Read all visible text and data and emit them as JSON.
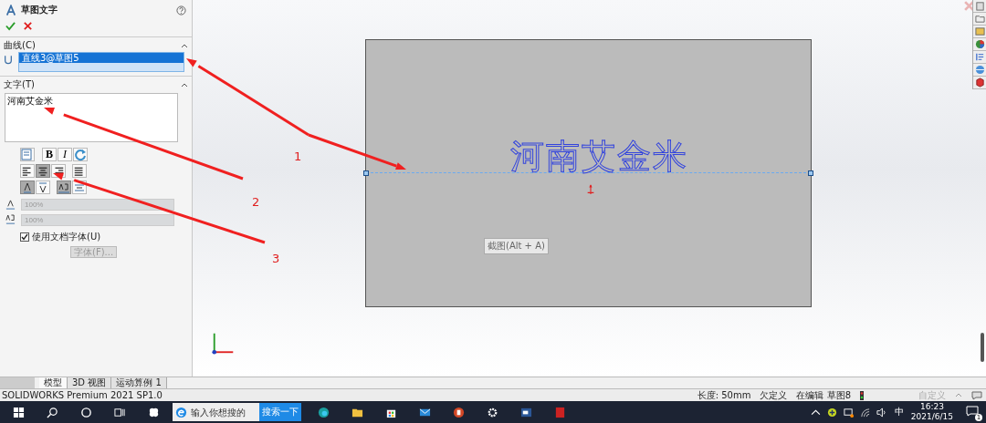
{
  "panel": {
    "title": "草图文字",
    "curves": {
      "heading": "曲线(C)",
      "items": [
        {
          "label": "直线3@草图5",
          "selected": true
        }
      ]
    },
    "text": {
      "heading": "文字(T)",
      "value": "河南艾金米"
    },
    "style_buttons": [
      {
        "label": "B",
        "kind": "bold"
      },
      {
        "label": "I",
        "kind": "italic"
      }
    ],
    "alignment": [
      {
        "kind": "left",
        "selected": false
      },
      {
        "kind": "center",
        "selected": true
      },
      {
        "kind": "right",
        "selected": false
      },
      {
        "kind": "justify",
        "selected": false
      }
    ],
    "flip": [
      {
        "kind": "vertical",
        "selected": true
      },
      {
        "kind": "down",
        "selected": false
      },
      {
        "kind": "horizontal",
        "selected": true
      },
      {
        "kind": "reverse",
        "selected": false
      }
    ],
    "width_factor": {
      "value": "100%",
      "disabled": true
    },
    "spacing": {
      "value": "100%",
      "disabled": true
    },
    "use_doc_font": {
      "label": "使用文档字体(U)",
      "checked": true
    },
    "font_button": {
      "label": "字体(F)...",
      "disabled": true
    }
  },
  "canvas": {
    "sketch_text": "河南艾金米",
    "tooltip": "截图(Alt + A)"
  },
  "annotations": [
    {
      "label": "1"
    },
    {
      "label": "2"
    },
    {
      "label": "3"
    }
  ],
  "tabs": [
    {
      "label": "模型",
      "selected": true
    },
    {
      "label": "3D 视图",
      "selected": false
    },
    {
      "label": "运动算例 1",
      "selected": false
    }
  ],
  "status_bar": {
    "product": "SOLIDWORKS Premium 2021 SP1.0",
    "length": "长度: 50mm",
    "state": "欠定义",
    "editing": "在编辑 草图8",
    "units": "自定义"
  },
  "taskbar": {
    "search_placeholder": "输入你想搜的",
    "search_button": "搜索一下",
    "ime": "中",
    "time": "16:23",
    "date": "2021/6/15",
    "notifications": "1"
  }
}
